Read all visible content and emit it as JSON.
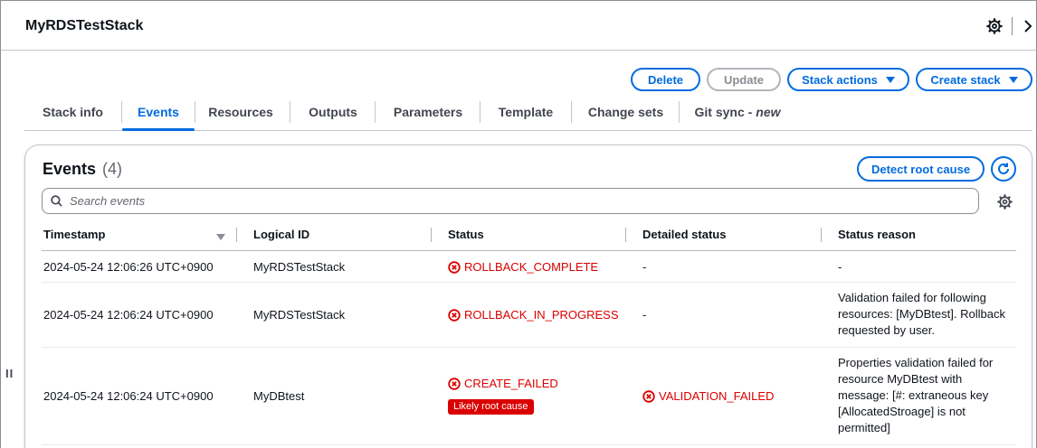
{
  "header": {
    "title": "MyRDSTestStack",
    "settings_icon": "gear-icon",
    "expand_icon": "chevron-right-icon"
  },
  "actions": {
    "delete": "Delete",
    "update": "Update",
    "stack_actions": "Stack actions",
    "create_stack": "Create stack"
  },
  "tabs": [
    {
      "label": "Stack info",
      "active": false
    },
    {
      "label": "Events",
      "active": true
    },
    {
      "label": "Resources",
      "active": false
    },
    {
      "label": "Outputs",
      "active": false
    },
    {
      "label": "Parameters",
      "active": false
    },
    {
      "label": "Template",
      "active": false
    },
    {
      "label": "Change sets",
      "active": false
    },
    {
      "label": "Git sync - ",
      "suffix": "new",
      "active": false
    }
  ],
  "events": {
    "title": "Events",
    "count": "(4)",
    "detect_root_cause": "Detect root cause",
    "search_placeholder": "Search events",
    "columns": [
      "Timestamp",
      "Logical ID",
      "Status",
      "Detailed status",
      "Status reason"
    ],
    "rows": [
      {
        "timestamp": "2024-05-24 12:06:26 UTC+0900",
        "logical_id": "MyRDSTestStack",
        "status": "ROLLBACK_COMPLETE",
        "detailed_status": "-",
        "status_reason": "-"
      },
      {
        "timestamp": "2024-05-24 12:06:24 UTC+0900",
        "logical_id": "MyRDSTestStack",
        "status": "ROLLBACK_IN_PROGRESS",
        "detailed_status": "-",
        "status_reason": [
          "Validation failed for following",
          "resources: [MyDBtest]. Rollback",
          "requested by user."
        ]
      },
      {
        "timestamp": "2024-05-24 12:06:24 UTC+0900",
        "logical_id": "MyDBtest",
        "status": "CREATE_FAILED",
        "badge": "Likely root cause",
        "detailed_status": "VALIDATION_FAILED",
        "status_reason": [
          "Properties validation failed for",
          "resource MyDBtest with",
          "message: [#: extraneous key",
          "[AllocatedStroage] is not",
          "permitted]"
        ]
      }
    ]
  },
  "colors": {
    "accent": "#006ce0",
    "error": "#db0000",
    "text": "#0f141a"
  }
}
